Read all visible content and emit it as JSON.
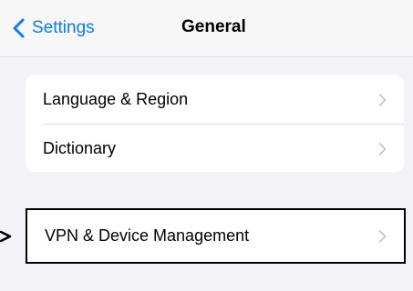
{
  "nav": {
    "back_label": "Settings",
    "title": "General"
  },
  "groups": {
    "top": {
      "items": [
        {
          "label": "Language & Region"
        },
        {
          "label": "Dictionary"
        }
      ]
    },
    "bottom": {
      "items": [
        {
          "label": "VPN & Device Management",
          "highlighted": true
        }
      ]
    }
  },
  "icons": {
    "back": "chevron-left-icon",
    "row": "chevron-right-icon",
    "annotation": "arrow-right-icon"
  },
  "colors": {
    "accent": "#0a7aff",
    "background": "#f2f2f7",
    "highlight_border": "#000000"
  }
}
